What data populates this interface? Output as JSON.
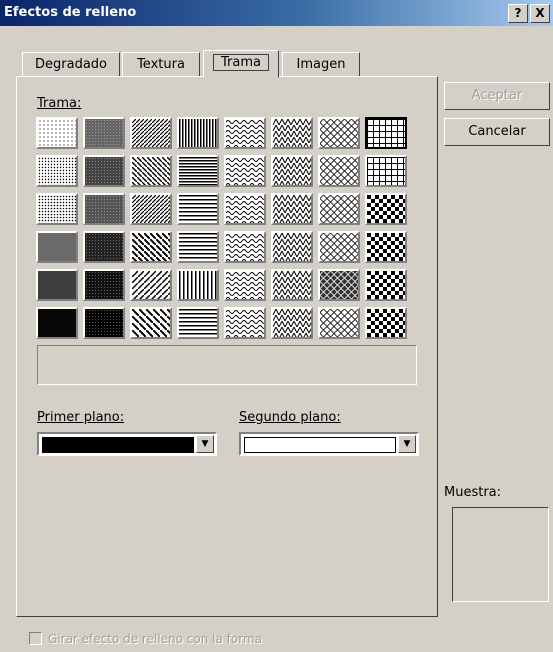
{
  "window": {
    "title": "Efectos de relleno",
    "help_button": "?",
    "close_button": "X"
  },
  "tabs": [
    {
      "label": "Degradado",
      "active": false
    },
    {
      "label": "Textura",
      "active": false
    },
    {
      "label": "Trama",
      "active": true
    },
    {
      "label": "Imagen",
      "active": false
    }
  ],
  "pattern_section": {
    "label": "Trama:",
    "selected_index": 7,
    "patterns": [
      "dots-5",
      "dark-grey",
      "dark-up-diagonal",
      "narrow-vertical",
      "wave-light",
      "wave-dark",
      "dotted-diamond",
      "small-grid",
      "dots-10",
      "dark-grey-2",
      "wide-up-diagonal",
      "narrow-horizontal",
      "zigzag",
      "wave-2",
      "grid-outline",
      "large-grid",
      "dots-20",
      "vertical-dark",
      "dark-down-diagonal",
      "dark-horizontal",
      "shingles",
      "zigzag-2",
      "plaid-light",
      "checker-small",
      "dots-25",
      "dots-50",
      "diagonal-wide",
      "horizontal-wide",
      "confetti",
      "brick",
      "trellis",
      "checker-large",
      "dots-30",
      "dots-70",
      "wide-down-diagonal",
      "wide-vertical",
      "dots-confetti",
      "solid-dots",
      "divot",
      "diagonal-cross",
      "dots-40",
      "dots-90",
      "dark-up-diagonal-wide",
      "dark-horizontal-wide",
      "random-dots",
      "stars",
      "large-confetti",
      "diamond-dots"
    ]
  },
  "foreground": {
    "label": "Primer plano:",
    "color": "#000000"
  },
  "background": {
    "label": "Segundo plano:",
    "color": "#ffffff"
  },
  "buttons": {
    "accept": "Aceptar",
    "cancel": "Cancelar"
  },
  "preview": {
    "label": "Muestra:"
  },
  "footer": {
    "rotate_checkbox_label": "Girar efecto de relleno con la forma",
    "rotate_checked": false
  }
}
